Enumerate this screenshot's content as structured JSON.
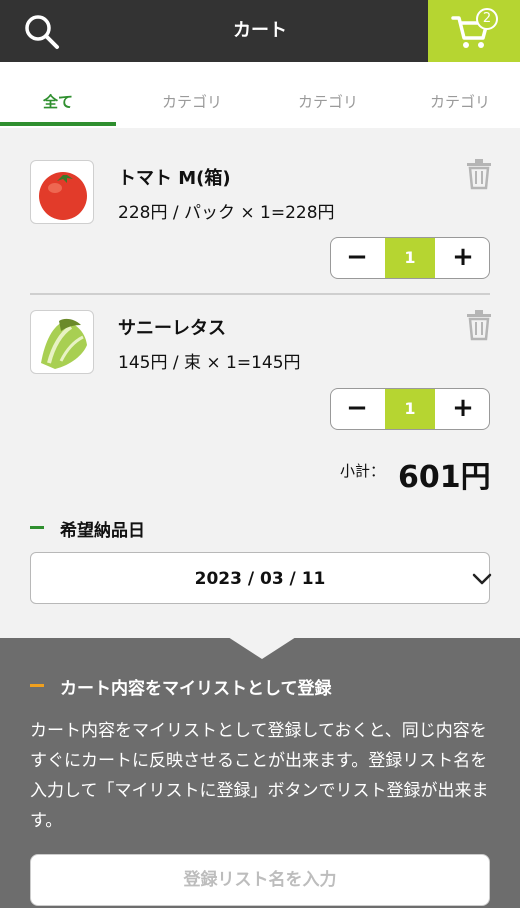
{
  "header": {
    "title": "カート",
    "cart_count": "2",
    "accent_color": "#b6d531",
    "bar_color": "#333333"
  },
  "tabs": [
    {
      "label": "全て",
      "active": true
    },
    {
      "label": "カテゴリ",
      "active": false
    },
    {
      "label": "カテゴリ",
      "active": false
    },
    {
      "label": "カテゴリ",
      "active": false
    }
  ],
  "cart_items": [
    {
      "name": "トマト M(箱)",
      "price_line": "228円 / パック × 1=228円",
      "quantity": "1",
      "image": "tomato"
    },
    {
      "name": "サニーレタス",
      "price_line": "145円 / 束 × 1=145円",
      "quantity": "1",
      "image": "lettuce"
    }
  ],
  "stepper": {
    "minus": "−",
    "plus": "+"
  },
  "subtotal": {
    "label": "小計：",
    "value": "601円"
  },
  "delivery": {
    "heading": "希望納品日",
    "date": "2023 / 03 / 11"
  },
  "mylist": {
    "heading": "カート内容をマイリストとして登録",
    "description": "カート内容をマイリストとして登録しておくと、同じ内容をすぐにカートに反映させることが出来ます。登録リスト名を入力して「マイリストに登録」ボタンでリスト登録が出来ます。",
    "input_placeholder": "登録リスト名を入力",
    "input_value": ""
  },
  "icons": {
    "search": "search-icon",
    "cart": "cart-icon",
    "trash": "trash-icon",
    "chevron": "chevron-down-icon"
  }
}
